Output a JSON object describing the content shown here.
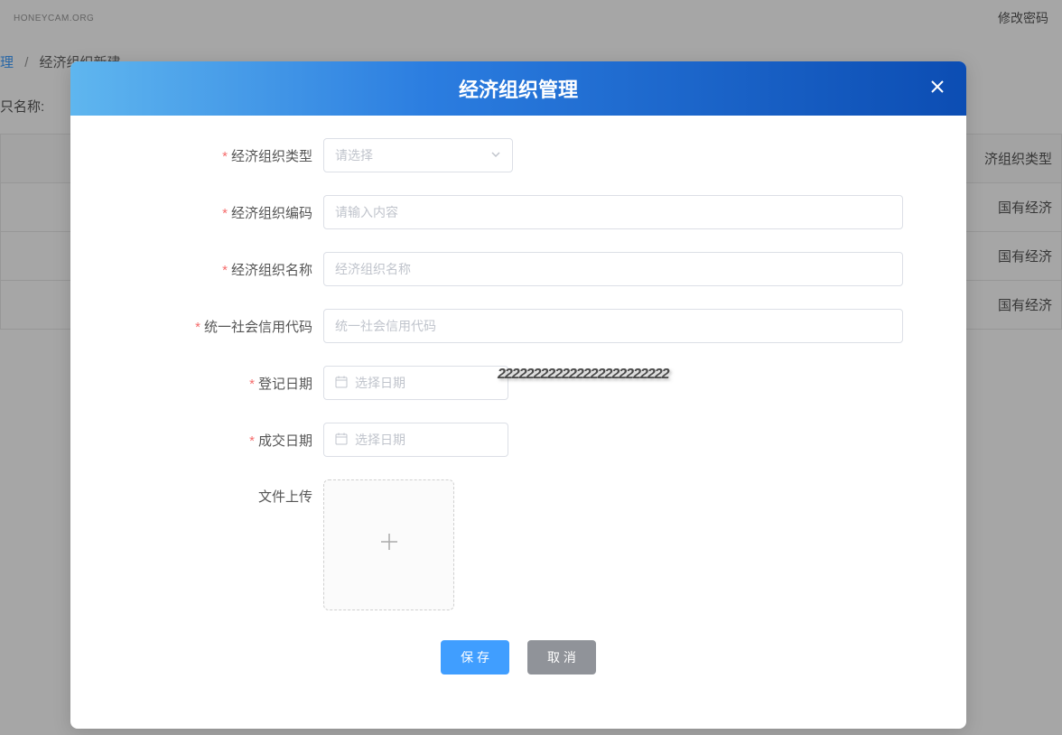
{
  "watermark": "HONEYCAM.ORG",
  "topbar_right": "修改密码",
  "breadcrumb": {
    "prev": "理",
    "sep": "/",
    "current": "经济组织新建"
  },
  "bg_label": "只名称:",
  "bg_table": {
    "header": "济组织类型",
    "rows": [
      "国有经济",
      "国有经济",
      "国有经济"
    ]
  },
  "modal": {
    "title": "经济组织管理",
    "fields": {
      "org_type": {
        "label": "经济组织类型",
        "placeholder": "请选择"
      },
      "org_code": {
        "label": "经济组织编码",
        "placeholder": "请输入内容"
      },
      "org_name": {
        "label": "经济组织名称",
        "placeholder": "经济组织名称"
      },
      "credit_code": {
        "label": "统一社会信用代码",
        "placeholder": "统一社会信用代码"
      },
      "reg_date": {
        "label": "登记日期",
        "placeholder": "选择日期"
      },
      "deal_date": {
        "label": "成交日期",
        "placeholder": "选择日期"
      },
      "file_upload": {
        "label": "文件上传"
      }
    },
    "buttons": {
      "save": "保 存",
      "cancel": "取 消"
    }
  },
  "overlay_marker": "222222222222222222222222"
}
